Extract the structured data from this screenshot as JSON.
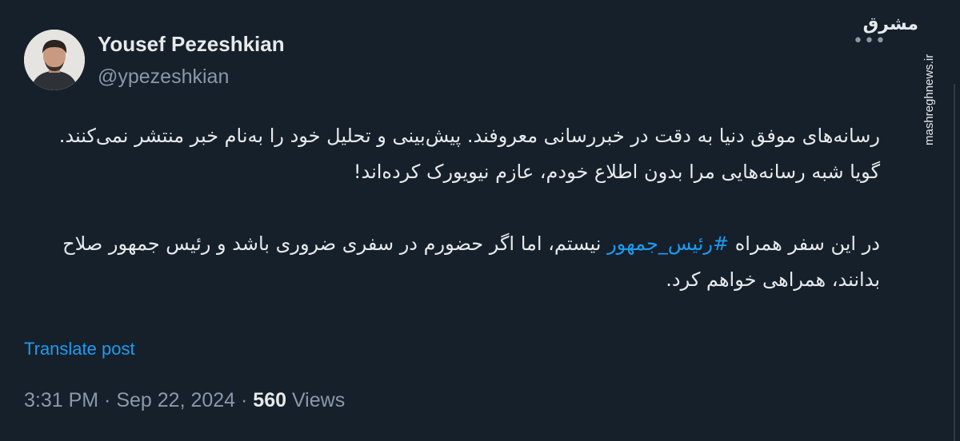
{
  "author": {
    "name": "Yousef Pezeshkian",
    "handle": "@ypezeshkian"
  },
  "more_icon": "more-icon",
  "watermark": {
    "logo_text": "مشرق",
    "url_text": "mashreghnews.ir"
  },
  "tweet": {
    "paragraph1": "رسانه‌های موفق دنیا به دقت در خبررسانی معروفند. پیش‌بینی و تحلیل خود را به‌نام خبر منتشر نمی‌کنند. گویا شبه رسانه‌هایی مرا بدون اطلاع خودم، عازم نیویورک کرده‌اند!",
    "p2_before": "در این سفر همراه ",
    "hashtag": "#رئیس_جمهور",
    "p2_after": " نیستم، اما اگر حضورم در سفری ضروری باشد و رئیس جمهور صلاح بدانند، همراهی خواهم کرد."
  },
  "translate_label": "Translate post",
  "meta": {
    "time": "3:31 PM",
    "separator": " · ",
    "date": "Sep 22, 2024",
    "views_count": "560",
    "views_label": " Views"
  },
  "colors": {
    "background": "#15202b",
    "text": "#e7e9ea",
    "secondary": "#8b98a5",
    "link": "#1d9bf0"
  }
}
